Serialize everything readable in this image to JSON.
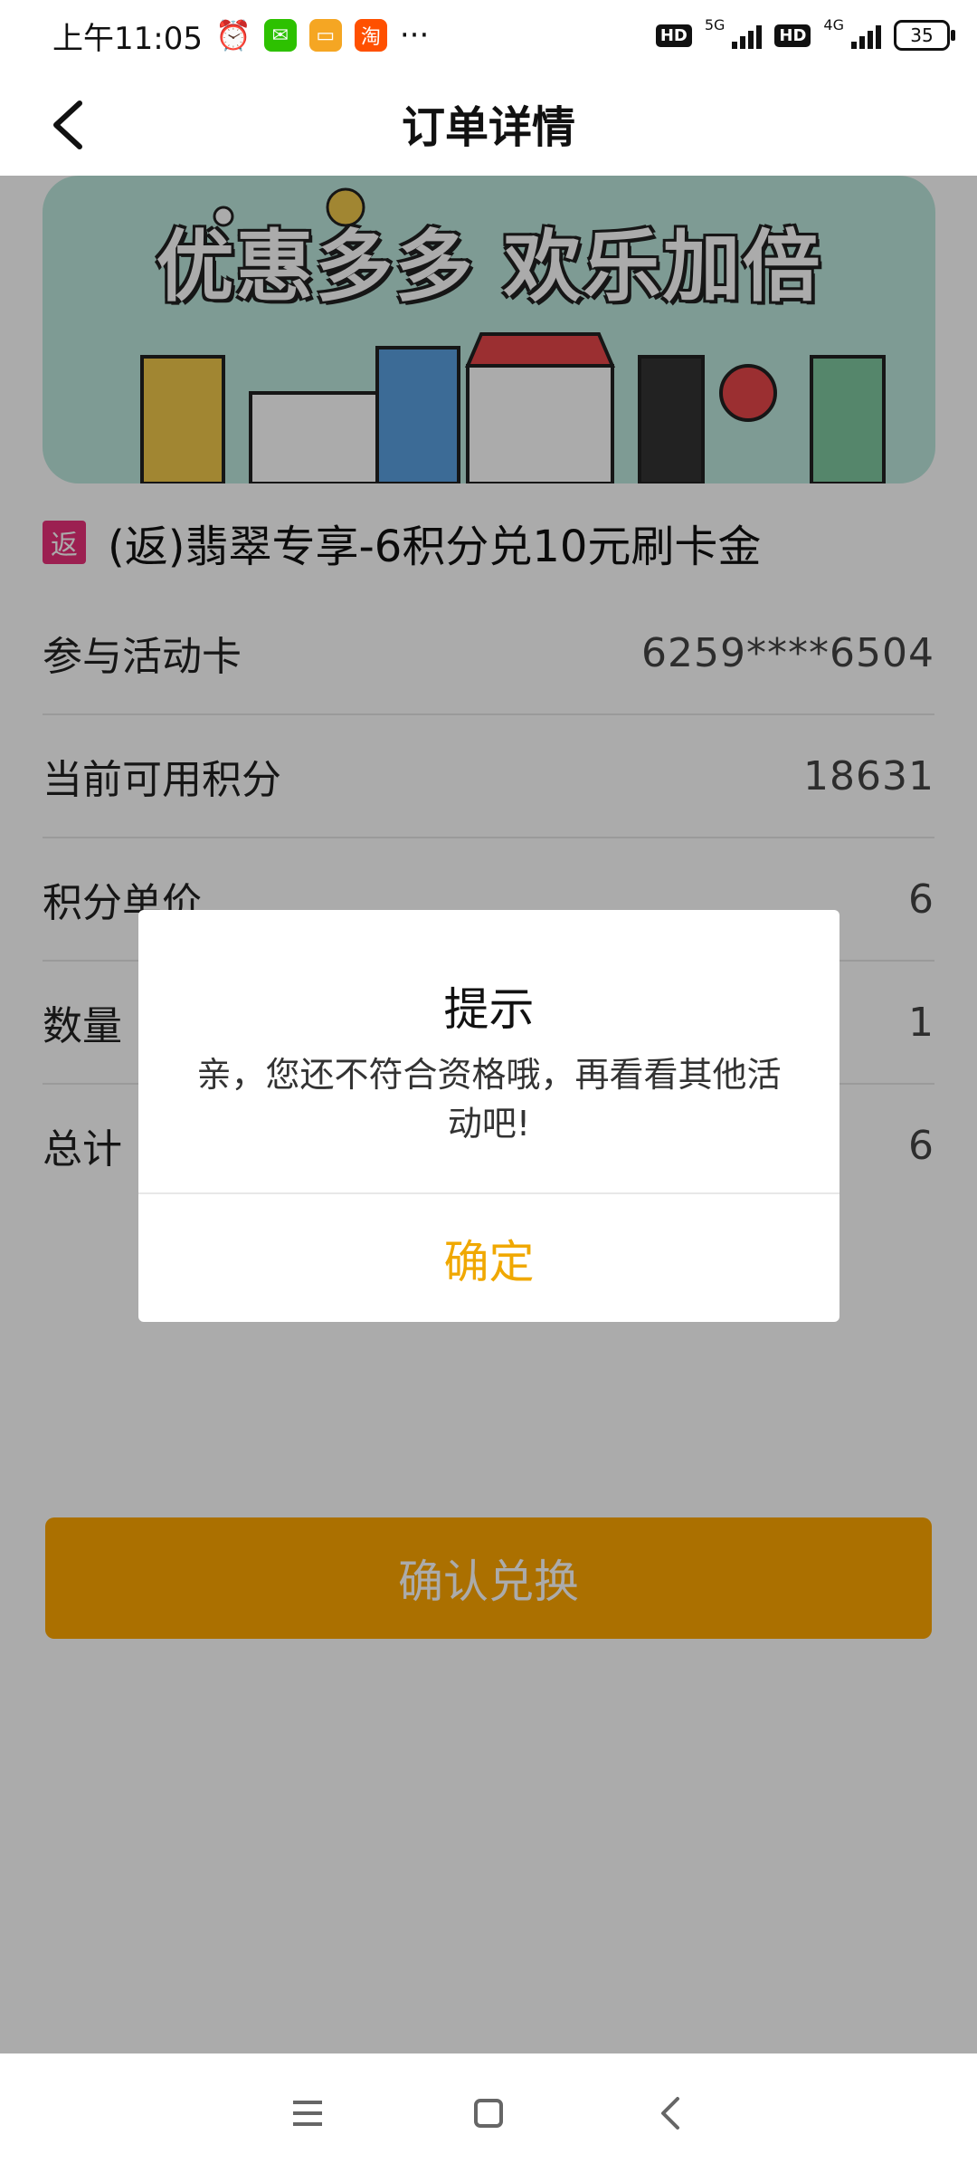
{
  "status_bar": {
    "time": "上午11:05",
    "apps": [
      "alarm-icon",
      "wechat-icon",
      "slides-icon",
      "taobao-icon"
    ],
    "more": "···",
    "hd1": "HD",
    "net1": "5G",
    "hd2": "HD",
    "net2": "4G",
    "battery": "35"
  },
  "header": {
    "title": "订单详情"
  },
  "banner": {
    "text": "优惠多多 欢乐加倍"
  },
  "product": {
    "tag": "返",
    "title": "(返)翡翠专享-6积分兑10元刷卡金"
  },
  "details": [
    {
      "label": "参与活动卡",
      "value": "6259****6504"
    },
    {
      "label": "当前可用积分",
      "value": "18631"
    },
    {
      "label": "积分单价",
      "value": "6"
    },
    {
      "label": "数量",
      "value": "1"
    },
    {
      "label": "总计",
      "value": "6"
    }
  ],
  "confirm_button": "确认兑换",
  "dialog": {
    "title": "提示",
    "message": "亲，您还不符合资格哦，再看看其他活动吧!",
    "ok": "确定"
  },
  "colors": {
    "accent": "#ffa800",
    "dialog_ok": "#f0a800",
    "tag": "#e9317a"
  }
}
